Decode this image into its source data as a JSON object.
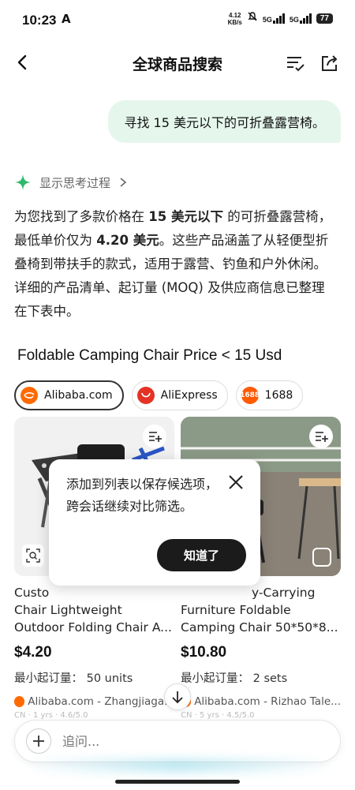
{
  "status": {
    "time": "10:23",
    "alert_glyph": "A",
    "net_speed_value": "4.12",
    "net_speed_unit": "KB/s",
    "sig1": "5G",
    "sig2": "5G",
    "battery": "77"
  },
  "header": {
    "title": "全球商品搜索"
  },
  "user_message": "寻找 15 美元以下的可折叠露营椅。",
  "thinking_label": "显示思考过程",
  "answer": {
    "p1": "为您找到了多款价格在 ",
    "b1": "15 美元以下",
    "p2": " 的可折叠露营椅，最低单价仅为 ",
    "b2": "4.20 美元",
    "p3": "。这些产品涵盖了从轻便型折叠椅到带扶手的款式，适用于露营、钓鱼和户外休闲。详细的产品清单、起订量 (MOQ) 及供应商信息已整理在下表中。"
  },
  "section_title": "Foldable Camping Chair Price < 15 Usd",
  "sources": [
    {
      "label": "Alibaba.com",
      "active": true,
      "color": "#ff6a00",
      "logo_text": "a"
    },
    {
      "label": "AliExpress",
      "active": false,
      "color": "#e43225",
      "logo_text": ""
    },
    {
      "label": "1688",
      "active": false,
      "color": "#ff5a00",
      "logo_text": "1688"
    }
  ],
  "products": [
    {
      "name": "Custom ... Chair Lightweight Outdoor Folding Chair A...",
      "name_visible": "Custo",
      "name_line2": "Chair Lightweight",
      "name_line3": "Outdoor Folding Chair A...",
      "price": "$4.20",
      "moq_label": "最小起订量：",
      "moq_value": "50 units",
      "seller": "Alibaba.com - Zhangjiaga...",
      "meta": "CN · 1 yrs · 4.6/5.0"
    },
    {
      "name_line1": "y-Carrying",
      "name_line2": "Furniture Foldable",
      "name_line3": "Camping Chair 50*50*8...",
      "price": "$10.80",
      "moq_label": "最小起订量：",
      "moq_value": "2 sets",
      "seller": "Alibaba.com - Rizhao Tale...",
      "meta": "CN · 5 yrs · 4.5/5.0"
    }
  ],
  "popover": {
    "message": "添加到列表以保存候选项，跨会话继续对比筛选。",
    "button": "知道了"
  },
  "composer": {
    "placeholder": "追问..."
  },
  "colors": {
    "accent_green": "#2fb86a",
    "bubble_bg": "#e5f6ed",
    "dark_button": "#1b1b1b"
  }
}
